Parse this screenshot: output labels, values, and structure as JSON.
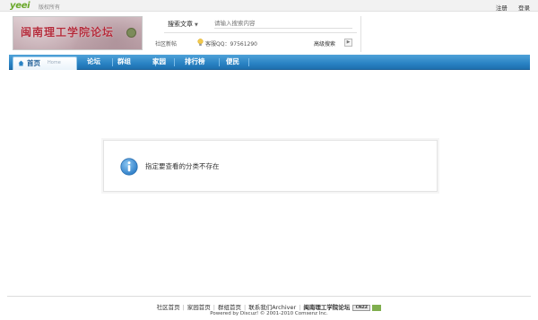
{
  "topbar": {
    "logo": "yeei",
    "logo_sub": "版权所有",
    "register": "注册",
    "login": "登录"
  },
  "header": {
    "banner_title": "闽南理工学院论坛",
    "search_type": "搜索文章",
    "search_placeholder": "请输入搜索内容",
    "new_post": "社区新帖",
    "qq_text": "客服QQ：97561290",
    "advanced_search": "高级搜索"
  },
  "nav": {
    "home": "首页",
    "home_sub": "Home",
    "items": [
      "论坛",
      "群组",
      "家园",
      "排行榜",
      "便民"
    ]
  },
  "message": {
    "text": "指定要查看的分类不存在"
  },
  "footer": {
    "links": [
      "社区首页",
      "家园首页",
      "群组首页",
      "联系我们Archiver"
    ],
    "site_name": "闽南理工学院论坛",
    "cnzz": "CNZZ",
    "powered": "Powered by Discuz! © 2001-2010 Comsenz Inc."
  },
  "colors": {
    "nav_blue": "#2a83c4",
    "info_blue": "#3d8fd6",
    "banner_red": "#b22a3a"
  },
  "icons": {
    "home": "house-icon",
    "qq": "bulb-icon",
    "info": "info-icon"
  }
}
